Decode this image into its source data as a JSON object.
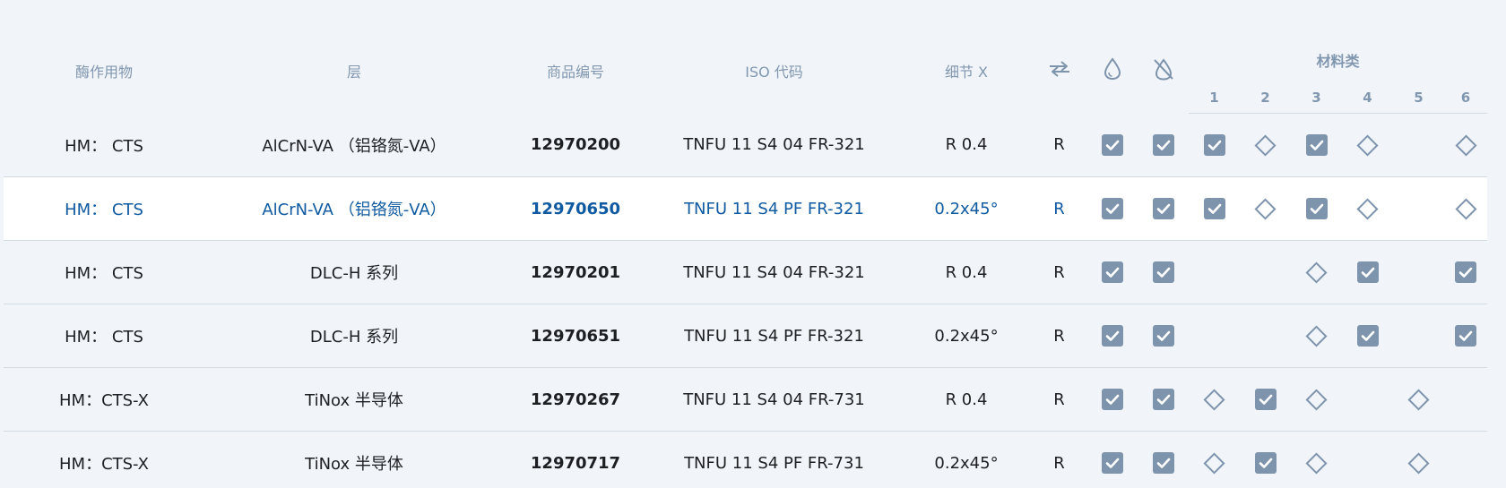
{
  "headers": {
    "substrate": "酶作用物",
    "layer": "层",
    "article": "商品编号",
    "iso": "ISO 代码",
    "detail": "细节 X",
    "material_group": "材料类",
    "material_numbers": [
      "1",
      "2",
      "3",
      "4",
      "5",
      "6"
    ],
    "icons": [
      "swap-arrows-icon",
      "coolant-drop-icon",
      "no-coolant-icon"
    ]
  },
  "colors": {
    "background": "#f1f4f8",
    "header_text": "#8197b0",
    "selected_text": "#0f5aa0",
    "checkbox": "#7e94ad",
    "divider": "#d3dbe4"
  },
  "rows": [
    {
      "substrate": "HM：   CTS",
      "layer": "AlCrN-VA （铝铬氮-VA）",
      "article": "12970200",
      "iso": "TNFU 11 S4 04 FR-321",
      "detail": "R 0.4",
      "hand": "R",
      "coolant": "check",
      "dry": "check",
      "materials": [
        "check",
        "diamond",
        "check",
        "diamond",
        "",
        "diamond"
      ],
      "selected": false
    },
    {
      "substrate": "HM：   CTS",
      "layer": "AlCrN-VA （铝铬氮-VA）",
      "article": "12970650",
      "iso": "TNFU 11 S4 PF FR-321",
      "detail": "0.2x45°",
      "hand": "R",
      "coolant": "check",
      "dry": "check",
      "materials": [
        "check",
        "diamond",
        "check",
        "diamond",
        "",
        "diamond"
      ],
      "selected": true
    },
    {
      "substrate": "HM：   CTS",
      "layer": "DLC-H 系列",
      "article": "12970201",
      "iso": "TNFU 11 S4 04 FR-321",
      "detail": "R 0.4",
      "hand": "R",
      "coolant": "check",
      "dry": "check",
      "materials": [
        "",
        "",
        "diamond",
        "check",
        "",
        "check"
      ],
      "selected": false
    },
    {
      "substrate": "HM：   CTS",
      "layer": "DLC-H 系列",
      "article": "12970651",
      "iso": "TNFU 11 S4 PF FR-321",
      "detail": "0.2x45°",
      "hand": "R",
      "coolant": "check",
      "dry": "check",
      "materials": [
        "",
        "",
        "diamond",
        "check",
        "",
        "check"
      ],
      "selected": false
    },
    {
      "substrate": "HM：CTS-X",
      "layer": "TiNox 半导体",
      "article": "12970267",
      "iso": "TNFU 11 S4 04 FR-731",
      "detail": "R 0.4",
      "hand": "R",
      "coolant": "check",
      "dry": "check",
      "materials": [
        "diamond",
        "check",
        "diamond",
        "",
        "diamond",
        ""
      ],
      "selected": false
    },
    {
      "substrate": "HM：CTS-X",
      "layer": "TiNox 半导体",
      "article": "12970717",
      "iso": "TNFU 11 S4 PF FR-731",
      "detail": "0.2x45°",
      "hand": "R",
      "coolant": "check",
      "dry": "check",
      "materials": [
        "diamond",
        "check",
        "diamond",
        "",
        "diamond",
        ""
      ],
      "selected": false
    }
  ]
}
